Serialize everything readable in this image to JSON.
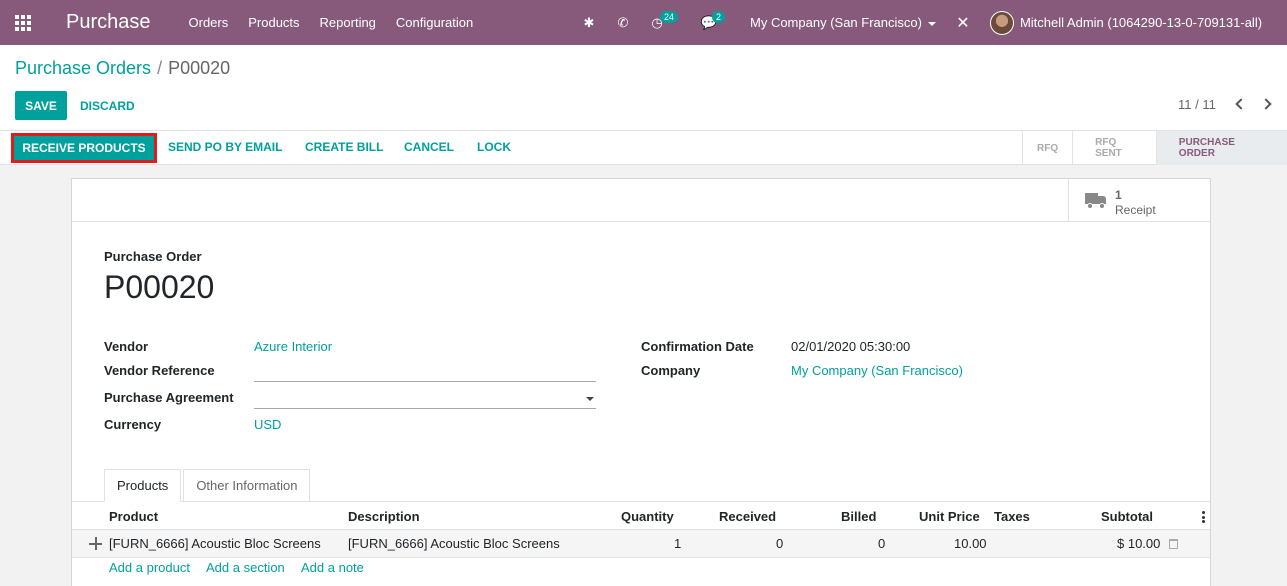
{
  "navbar": {
    "app_name": "Purchase",
    "menu": [
      "Orders",
      "Products",
      "Reporting",
      "Configuration"
    ],
    "activity_badge": "24",
    "messages_badge": "2",
    "company": "My Company (San Francisco)",
    "user": "Mitchell Admin (1064290-13-0-709131-all)",
    "bg_color": "#875a7b"
  },
  "breadcrumb": {
    "parent": "Purchase Orders",
    "separator": "/",
    "current": "P00020"
  },
  "actions": {
    "save": "SAVE",
    "discard": "DISCARD"
  },
  "pager": {
    "value": "11 / 11"
  },
  "statusbar": {
    "buttons": [
      "RECEIVE PRODUCTS",
      "SEND PO BY EMAIL",
      "CREATE BILL",
      "CANCEL",
      "LOCK"
    ],
    "stages": [
      "RFQ",
      "RFQ SENT",
      "PURCHASE ORDER"
    ],
    "active_stage": "PURCHASE ORDER"
  },
  "smart_button": {
    "count": "1",
    "label": "Receipt",
    "icon": "truck-icon"
  },
  "form": {
    "doc_label": "Purchase Order",
    "doc_name": "P00020",
    "vendor_label": "Vendor",
    "vendor_value": "Azure Interior",
    "vendor_ref_label": "Vendor Reference",
    "vendor_ref_value": "",
    "agreement_label": "Purchase Agreement",
    "agreement_value": "",
    "currency_label": "Currency",
    "currency_value": "USD",
    "confirmation_label": "Confirmation Date",
    "confirmation_value": "02/01/2020 05:30:00",
    "company_label": "Company",
    "company_value": "My Company (San Francisco)"
  },
  "tabs": [
    "Products",
    "Other Information"
  ],
  "order_lines": {
    "columns": [
      "Product",
      "Description",
      "Quantity",
      "Received",
      "Billed",
      "Unit Price",
      "Taxes",
      "Subtotal"
    ],
    "rows": [
      {
        "product": "[FURN_6666] Acoustic Bloc Screens",
        "description": "[FURN_6666] Acoustic Bloc Screens",
        "quantity": "1",
        "received": "0",
        "billed": "0",
        "unit_price": "10.00",
        "taxes": "",
        "subtotal": "$ 10.00"
      }
    ],
    "add_links": [
      "Add a product",
      "Add a section",
      "Add a note"
    ]
  }
}
